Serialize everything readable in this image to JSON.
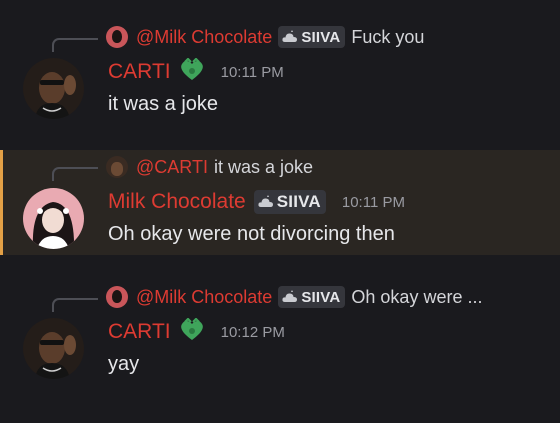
{
  "messages": [
    {
      "reply": {
        "author": "@Milk Chocolate",
        "tag": "SIIVA",
        "text": "Fuck you"
      },
      "author": "CARTI",
      "time": "10:11 PM",
      "content": "it was a joke"
    },
    {
      "reply": {
        "author": "@CARTI",
        "text": "it was a joke"
      },
      "author": "Milk Chocolate",
      "tag": "SIIVA",
      "time": "10:11 PM",
      "content": "Oh okay were not divorcing then"
    },
    {
      "reply": {
        "author": "@Milk Chocolate",
        "tag": "SIIVA",
        "text": "Oh okay were ..."
      },
      "author": "CARTI",
      "time": "10:12 PM",
      "content": "yay"
    }
  ],
  "colors": {
    "background": "#1a1a1e",
    "highlight_background": "#2a2622",
    "highlight_bar": "#e3a046",
    "author_name": "#dd3b32",
    "message_text": "#e6e7ea",
    "timestamp": "#9a9ba2",
    "heart_badge": "#3fa55b"
  },
  "icons": {
    "author_badge": "green-heart-badge-icon",
    "tag_icon": "cloud-tag-icon"
  }
}
